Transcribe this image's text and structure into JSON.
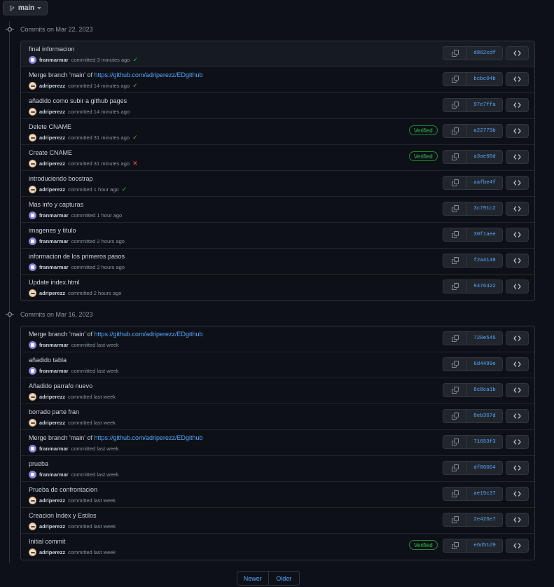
{
  "branch": {
    "label": "main",
    "icon": "git-branch-icon"
  },
  "groups": [
    {
      "header": "Commits on Mar 22, 2023",
      "commits": [
        {
          "title": "final informacion",
          "link": "",
          "author": "franmarmar",
          "avatar": "fran",
          "time": "committed 3 minutes ago",
          "status": "ok",
          "verified": "",
          "sha": "d862cdf"
        },
        {
          "title": "Merge branch 'main' of ",
          "link": "https://github.com/adriperezz/EDgithub",
          "author": "adriperezz",
          "avatar": "adri",
          "time": "committed 14 minutes ago",
          "status": "ok",
          "verified": "",
          "sha": "bcbc04b"
        },
        {
          "title": "añadido como subir a github pages",
          "link": "",
          "author": "adriperezz",
          "avatar": "adri",
          "time": "committed 14 minutes ago",
          "status": "",
          "verified": "",
          "sha": "97e7ffa"
        },
        {
          "title": "Delete CNAME",
          "link": "",
          "author": "adriperezz",
          "avatar": "adri",
          "time": "committed 31 minutes ago",
          "status": "ok",
          "verified": "Verified",
          "sha": "a22779b"
        },
        {
          "title": "Create CNAME",
          "link": "",
          "author": "adriperezz",
          "avatar": "adri",
          "time": "committed 31 minutes ago",
          "status": "fail",
          "verified": "Verified",
          "sha": "a3ae68d"
        },
        {
          "title": "introduciendo boostrap",
          "link": "",
          "author": "adriperezz",
          "avatar": "adri",
          "time": "committed 1 hour ago",
          "status": "ok",
          "verified": "",
          "sha": "aafbe4f"
        },
        {
          "title": "Mas info y capturas",
          "link": "",
          "author": "franmarmar",
          "avatar": "fran",
          "time": "committed 1 hour ago",
          "status": "",
          "verified": "",
          "sha": "3c791c2"
        },
        {
          "title": "imagenes y titulo",
          "link": "",
          "author": "franmarmar",
          "avatar": "fran",
          "time": "committed 2 hours ago",
          "status": "",
          "verified": "",
          "sha": "30f1aee"
        },
        {
          "title": "informacion de los primeros pasos",
          "link": "",
          "author": "franmarmar",
          "avatar": "fran",
          "time": "committed 2 hours ago",
          "status": "",
          "verified": "",
          "sha": "f2a4148"
        },
        {
          "title": "Update index.html",
          "link": "",
          "author": "adriperezz",
          "avatar": "adri",
          "time": "committed 2 hours ago",
          "status": "",
          "verified": "",
          "sha": "9476422"
        }
      ]
    },
    {
      "header": "Commits on Mar 16, 2023",
      "commits": [
        {
          "title": "Merge branch 'main' of ",
          "link": "https://github.com/adriperezz/EDgithub",
          "author": "franmarmar",
          "avatar": "fran",
          "time": "committed last week",
          "status": "",
          "verified": "",
          "sha": "720e545"
        },
        {
          "title": "añadido tabla",
          "link": "",
          "author": "franmarmar",
          "avatar": "fran",
          "time": "committed last week",
          "status": "",
          "verified": "",
          "sha": "6d4499e"
        },
        {
          "title": "Añadido parrafo nuevo",
          "link": "",
          "author": "adriperezz",
          "avatar": "adri",
          "time": "committed last week",
          "status": "",
          "verified": "",
          "sha": "8c8ca1b"
        },
        {
          "title": "borrado parte fran",
          "link": "",
          "author": "adriperezz",
          "avatar": "adri",
          "time": "committed last week",
          "status": "",
          "verified": "",
          "sha": "8eb367d"
        },
        {
          "title": "Merge branch 'main' of ",
          "link": "https://github.com/adriperezz/EDgithub",
          "author": "franmarmar",
          "avatar": "fran",
          "time": "committed last week",
          "status": "",
          "verified": "",
          "sha": "71653f3"
        },
        {
          "title": "prueba",
          "link": "",
          "author": "franmarmar",
          "avatar": "fran",
          "time": "committed last week",
          "status": "",
          "verified": "",
          "sha": "df06064"
        },
        {
          "title": "Prueba de confrontacion",
          "link": "",
          "author": "adriperezz",
          "avatar": "adri",
          "time": "committed last week",
          "status": "",
          "verified": "",
          "sha": "ae15c37"
        },
        {
          "title": "Creacion Index y Estilos",
          "link": "",
          "author": "adriperezz",
          "avatar": "adri",
          "time": "committed last week",
          "status": "",
          "verified": "",
          "sha": "2e426e7"
        },
        {
          "title": "Initial commit",
          "link": "",
          "author": "adriperezz",
          "avatar": "adri",
          "time": "committed last week",
          "status": "",
          "verified": "Verified",
          "sha": "e6d51d9"
        }
      ]
    }
  ],
  "pagination": {
    "newer": "Newer",
    "older": "Older"
  },
  "colors": {
    "link": "#58a6ff",
    "success": "#3fb950",
    "failure": "#f85149",
    "background": "#0d1117"
  }
}
